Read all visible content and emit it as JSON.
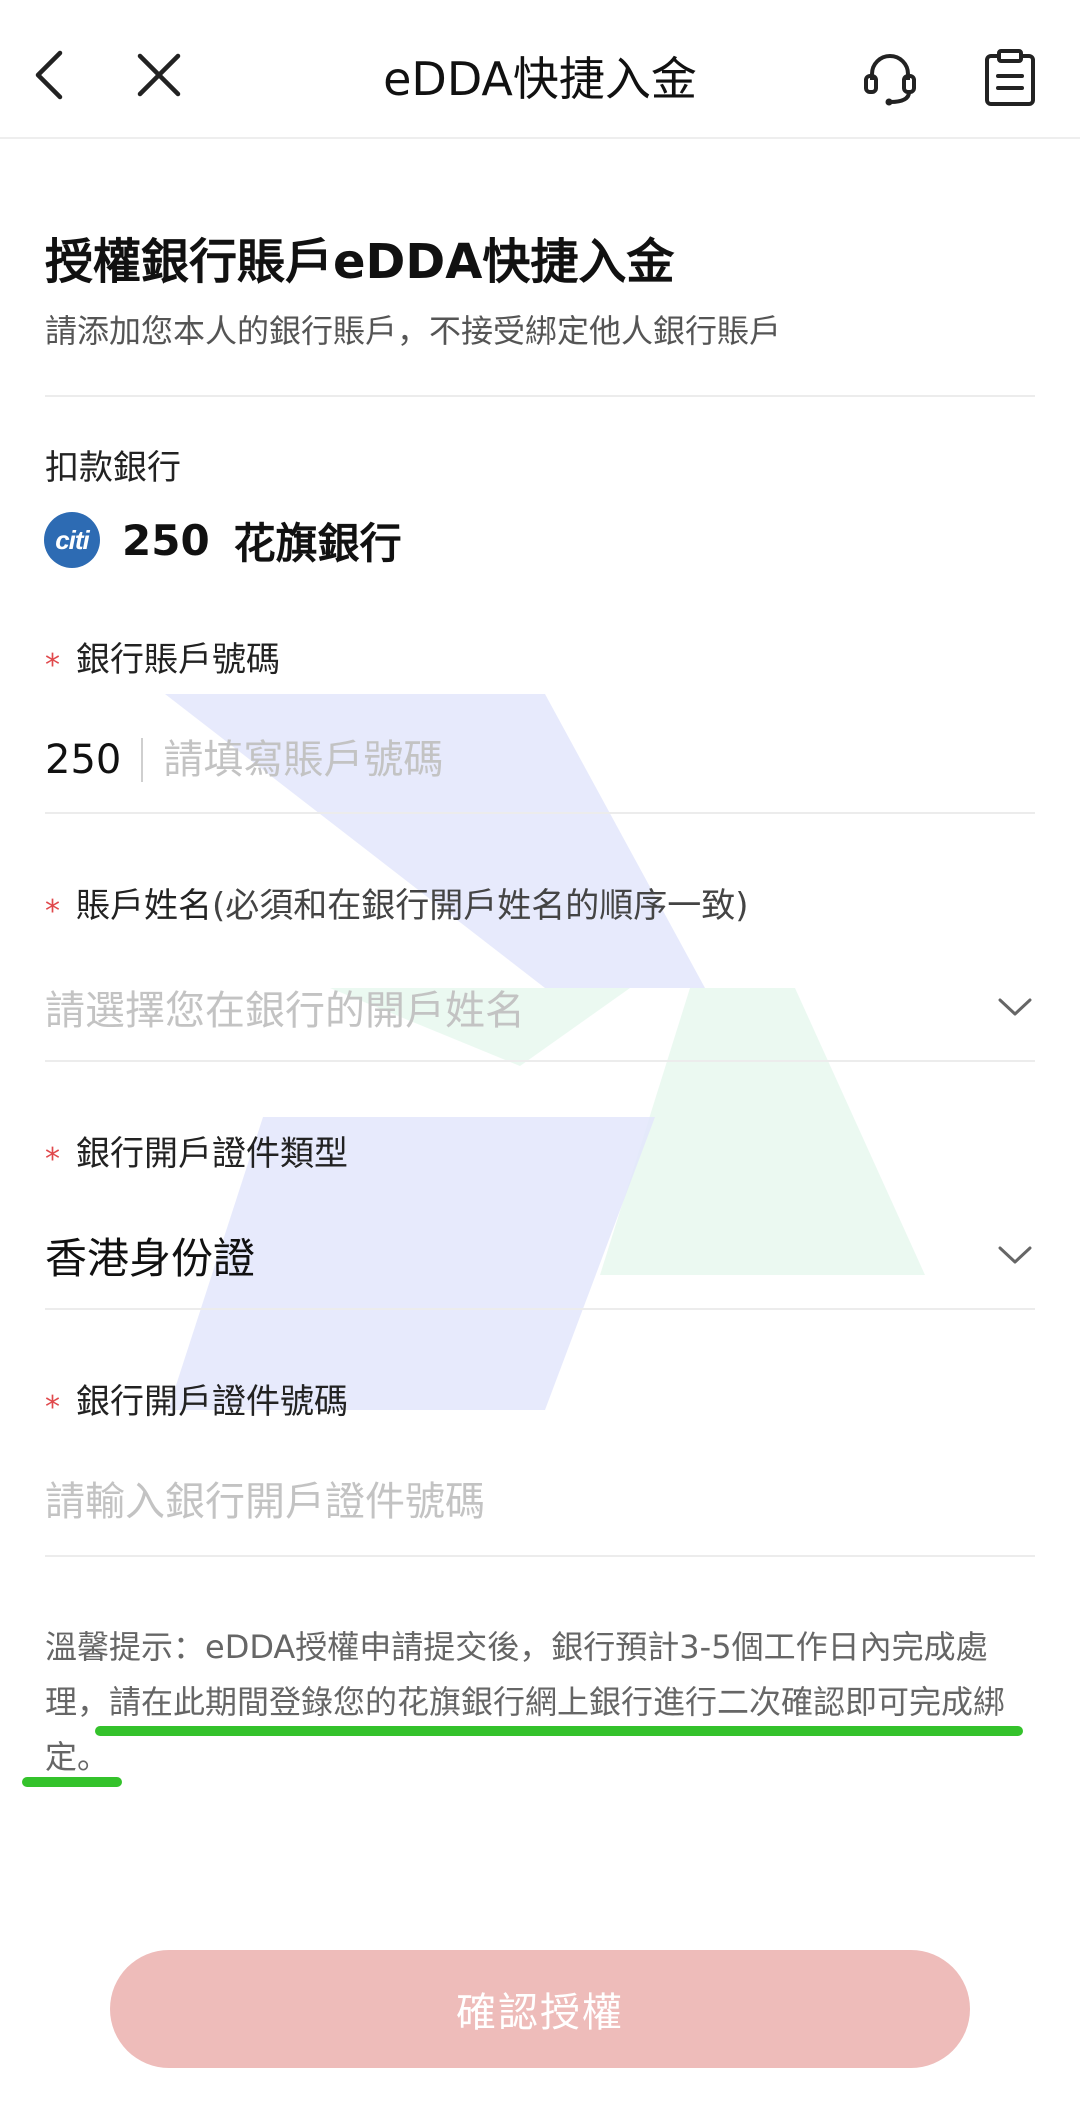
{
  "nav": {
    "title": "eDDA快捷入金"
  },
  "intro": {
    "heading": "授權銀行賬戶eDDA快捷入金",
    "subheading": "請添加您本人的銀行賬戶，不接受綁定他人銀行賬戶"
  },
  "debit_bank": {
    "label": "扣款銀行",
    "logo_text": "citi",
    "code": "250",
    "name": "花旗銀行"
  },
  "account_number": {
    "required_mark": "*",
    "label": "銀行賬戶號碼",
    "prefix": "250",
    "value": "",
    "placeholder": "請填寫賬戶號碼"
  },
  "account_name": {
    "required_mark": "*",
    "label": "賬戶姓名",
    "label_note": "(必須和在銀行開戶姓名的順序一致)",
    "placeholder": "請選擇您在銀行的開戶姓名"
  },
  "id_type": {
    "required_mark": "*",
    "label": "銀行開戶證件類型",
    "value": "香港身份證"
  },
  "id_number": {
    "required_mark": "*",
    "label": "銀行開戶證件號碼",
    "value": "",
    "placeholder": "請輸入銀行開戶證件號碼"
  },
  "tip": {
    "text": "溫馨提示：eDDA授權申請提交後，銀行預計3-5個工作日內完成處理，請在此期間登錄您的花旗銀行網上銀行進行二次確認即可完成綁定。"
  },
  "confirm_button": {
    "label": "確認授權"
  },
  "colors": {
    "required": "#e0494c",
    "button_bg": "#eebcba",
    "annotation_underline": "#34c22b",
    "citi_blue": "#2d6bb3"
  },
  "icons": {
    "back": "chevron-left-icon",
    "close": "close-icon",
    "support": "headset-icon",
    "records": "clipboard-icon",
    "dropdown": "chevron-down-icon"
  }
}
